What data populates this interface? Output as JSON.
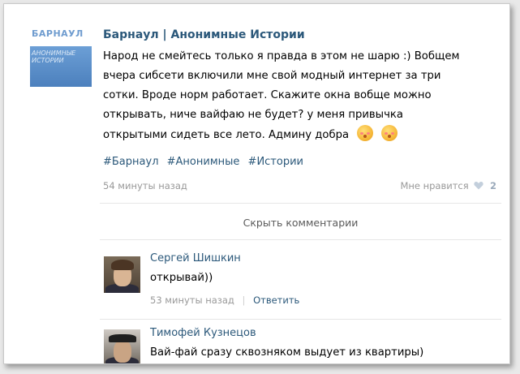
{
  "post": {
    "group_avatar": {
      "title": "БАРНАУЛ",
      "subtitle": "АНОНИМНЫЕ ИСТОРИИ"
    },
    "group_name": "Барнаул | Анонимные Истории",
    "text_lines": [
      "Народ не смейтесь только я правда в этом не шарю :) Вобщем",
      "вчера сибсети включили мне свой модный интернет за три",
      "сотки. Вроде норм работает. Скажите окна вобще можно",
      "открывать, ниче вайфаю не будет? у меня привычка",
      "открытыми сидеть все лето. Админу добра"
    ],
    "emoji_icons": [
      "kissing-face-icon",
      "kissing-face-icon"
    ],
    "hashtags": [
      "#Барнаул",
      "#Анонимные",
      "#Истории"
    ],
    "time": "54 минуты назад",
    "like_label": "Мне нравится",
    "like_count": "2",
    "hide_comments": "Скрыть комментарии"
  },
  "comments": [
    {
      "author": "Сергей Шишкин",
      "text": "открывай))",
      "time": "53 минуты назад",
      "reply_label": "Ответить"
    },
    {
      "author": "Тимофей Кузнецов",
      "text": "Вай-фай сразу сквозняком выдует из квартиры)"
    }
  ],
  "colors": {
    "link": "#2b587a",
    "meta": "#999999",
    "accent": "#4c80bd"
  }
}
